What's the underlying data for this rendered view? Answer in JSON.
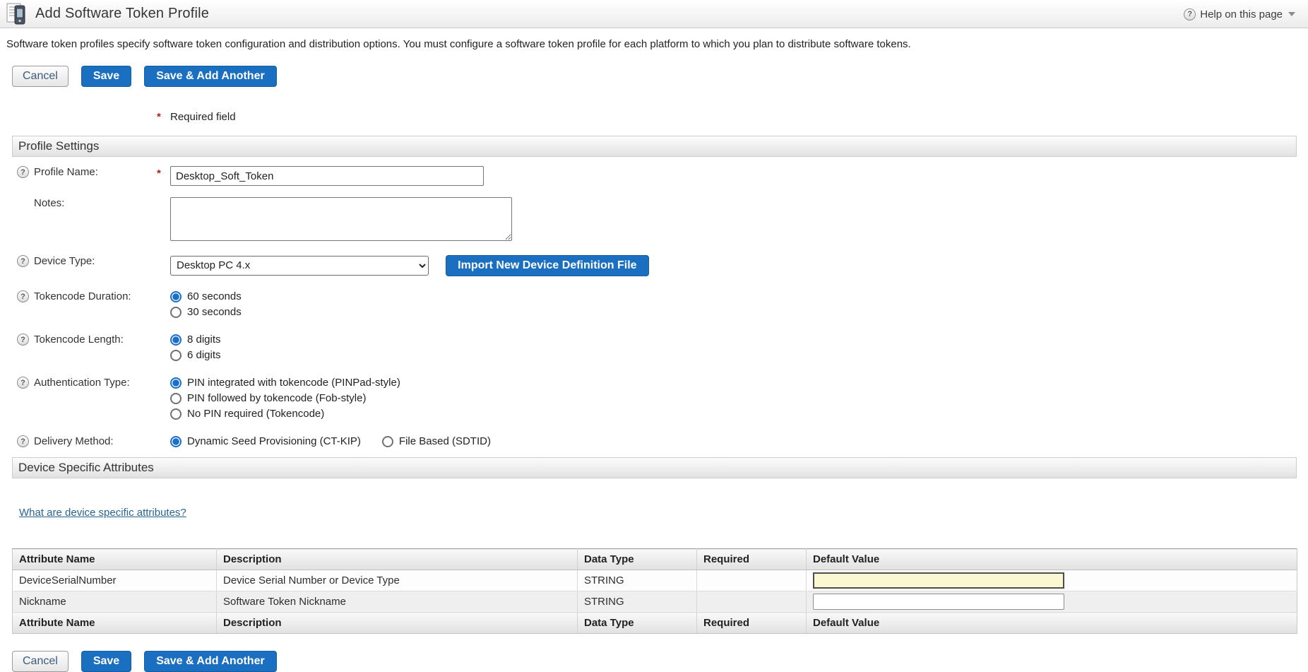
{
  "page": {
    "title": "Add Software Token Profile",
    "help_link": "Help on this page",
    "description": "Software token profiles specify software token configuration and distribution options. You must configure a software token profile for each platform to which you plan to distribute software tokens.",
    "required_note": "Required field"
  },
  "buttons": {
    "cancel": "Cancel",
    "save": "Save",
    "save_add_another": "Save & Add Another"
  },
  "sections": {
    "profile_settings": "Profile Settings",
    "device_specific_attributes": "Device Specific Attributes"
  },
  "form": {
    "profile_name": {
      "label": "Profile Name:",
      "value": "Desktop_Soft_Token"
    },
    "notes": {
      "label": "Notes:",
      "value": ""
    },
    "device_type": {
      "label": "Device Type:",
      "selected": "Desktop PC 4.x",
      "import_button": "Import New Device Definition File"
    },
    "tokencode_duration": {
      "label": "Tokencode Duration:",
      "options": [
        "60 seconds",
        "30 seconds"
      ],
      "selected_index": 0
    },
    "tokencode_length": {
      "label": "Tokencode Length:",
      "options": [
        "8 digits",
        "6 digits"
      ],
      "selected_index": 0
    },
    "authentication_type": {
      "label": "Authentication Type:",
      "options": [
        "PIN integrated with tokencode (PINPad-style)",
        "PIN followed by tokencode (Fob-style)",
        "No PIN required (Tokencode)"
      ],
      "selected_index": 0
    },
    "delivery_method": {
      "label": "Delivery Method:",
      "options": [
        "Dynamic Seed Provisioning (CT-KIP)",
        "File Based (SDTID)"
      ],
      "selected_index": 0
    }
  },
  "attributes_link": "What are device specific attributes?",
  "table": {
    "headers": [
      "Attribute Name",
      "Description",
      "Data Type",
      "Required",
      "Default Value"
    ],
    "rows": [
      {
        "name": "DeviceSerialNumber",
        "description": "Device Serial Number or Device Type",
        "data_type": "STRING",
        "required": "",
        "default_value": ""
      },
      {
        "name": "Nickname",
        "description": "Software Token Nickname",
        "data_type": "STRING",
        "required": "",
        "default_value": ""
      }
    ]
  },
  "colors": {
    "primary_button": "#1b6fc0",
    "link": "#29638f",
    "required_asterisk": "#b51d1d",
    "radio_selected": "#1a6fc9",
    "focused_input_bg": "#faf8d0",
    "section_bar_bg": "#e2e2e2"
  }
}
